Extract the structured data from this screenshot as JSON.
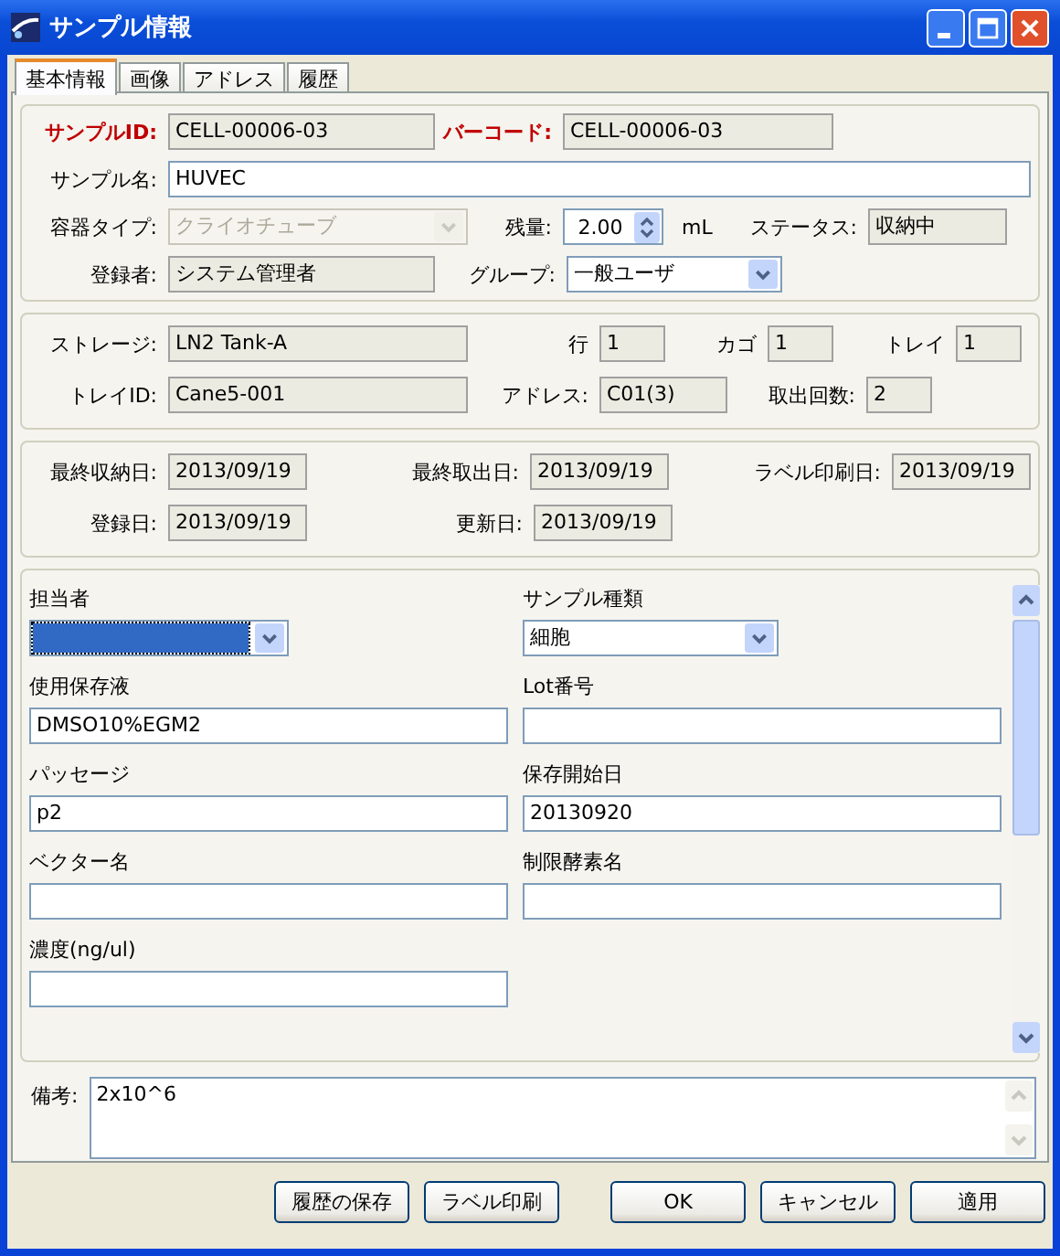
{
  "window": {
    "title": "サンプル情報"
  },
  "tabs": [
    {
      "label": "基本情報",
      "selected": true
    },
    {
      "label": "画像",
      "selected": false
    },
    {
      "label": "アドレス",
      "selected": false
    },
    {
      "label": "履歴",
      "selected": false
    }
  ],
  "basic": {
    "sample_id": {
      "label": "サンプルID:",
      "value": "CELL-00006-03"
    },
    "barcode": {
      "label": "バーコード:",
      "value": "CELL-00006-03"
    },
    "sample_name": {
      "label": "サンプル名:",
      "value": "HUVEC"
    },
    "container_type": {
      "label": "容器タイプ:",
      "value": "クライオチューブ",
      "disabled": true
    },
    "remaining": {
      "label": "残量:",
      "value": "2.00",
      "unit": "mL"
    },
    "status": {
      "label": "ステータス:",
      "value": "収納中"
    },
    "registrant": {
      "label": "登録者:",
      "value": "システム管理者"
    },
    "group": {
      "label": "グループ:",
      "value": "一般ユーザ",
      "disabled": false
    }
  },
  "storage": {
    "storage": {
      "label": "ストレージ:",
      "value": "LN2 Tank-A"
    },
    "row": {
      "label": "行",
      "value": "1"
    },
    "cage": {
      "label": "カゴ",
      "value": "1"
    },
    "tray": {
      "label": "トレイ",
      "value": "1"
    },
    "tray_id": {
      "label": "トレイID:",
      "value": "Cane5-001"
    },
    "address": {
      "label": "アドレス:",
      "value": "C01(3)"
    },
    "retrieval_count": {
      "label": "取出回数:",
      "value": "2"
    }
  },
  "dates": {
    "last_stored": {
      "label": "最終収納日:",
      "value": "2013/09/19"
    },
    "last_retrieved": {
      "label": "最終取出日:",
      "value": "2013/09/19"
    },
    "label_printed": {
      "label": "ラベル印刷日:",
      "value": "2013/09/19"
    },
    "registered": {
      "label": "登録日:",
      "value": "2013/09/19"
    },
    "updated": {
      "label": "更新日:",
      "value": "2013/09/19"
    }
  },
  "custom_fields": [
    {
      "label": "担当者",
      "kind": "dropdown",
      "focused": true
    },
    {
      "label": "サンプル種類",
      "kind": "dropdown",
      "value": "細胞",
      "focused": false
    },
    {
      "label": "使用保存液",
      "kind": "text",
      "value": "DMSO10%EGM2"
    },
    {
      "label": "Lot番号",
      "kind": "text"
    },
    {
      "label": "パッセージ",
      "kind": "text",
      "value": "p2"
    },
    {
      "label": "保存開始日",
      "kind": "text",
      "value": "20130920"
    },
    {
      "label": "ベクター名",
      "kind": "text"
    },
    {
      "label": "制限酵素名",
      "kind": "text"
    },
    {
      "label": "濃度(ng/ul)",
      "kind": "text"
    }
  ],
  "remarks": {
    "label": "備考:",
    "value": "2x10^6"
  },
  "buttons": [
    "履歴の保存",
    "ラベル印刷",
    "OK",
    "キャンセル",
    "適用"
  ]
}
